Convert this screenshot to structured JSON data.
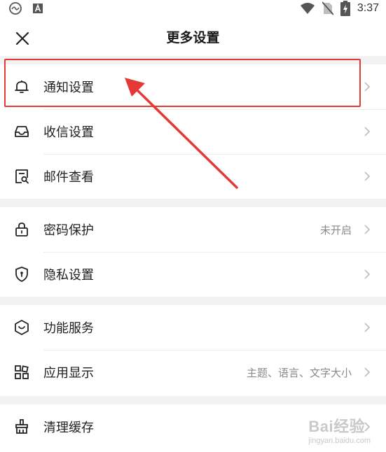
{
  "status_bar": {
    "time": "3:37",
    "left_icons": [
      "rotation-icon",
      "a-badge-icon"
    ],
    "right_icons": [
      "wifi-icon",
      "no-sim-icon",
      "battery-charging-icon"
    ]
  },
  "header": {
    "title": "更多设置",
    "close_icon": "close-icon"
  },
  "groups": [
    {
      "items": [
        {
          "label": "通知设置",
          "icon": "bell-icon",
          "value": ""
        },
        {
          "label": "收信设置",
          "icon": "inbox-icon",
          "value": ""
        },
        {
          "label": "邮件查看",
          "icon": "mail-view-icon",
          "value": ""
        }
      ]
    },
    {
      "items": [
        {
          "label": "密码保护",
          "icon": "lock-icon",
          "value": "未开启"
        },
        {
          "label": "隐私设置",
          "icon": "shield-icon",
          "value": ""
        }
      ]
    },
    {
      "items": [
        {
          "label": "功能服务",
          "icon": "service-icon",
          "value": ""
        },
        {
          "label": "应用显示",
          "icon": "apps-icon",
          "value": "主题、语言、文字大小"
        }
      ]
    },
    {
      "items": [
        {
          "label": "清理缓存",
          "icon": "broom-icon",
          "value": ""
        }
      ]
    }
  ],
  "annotation": {
    "highlight_color": "#e53935",
    "target": "通知设置"
  },
  "watermark": {
    "brand": "Bai经验",
    "site": "jingyan.baidu.com"
  }
}
